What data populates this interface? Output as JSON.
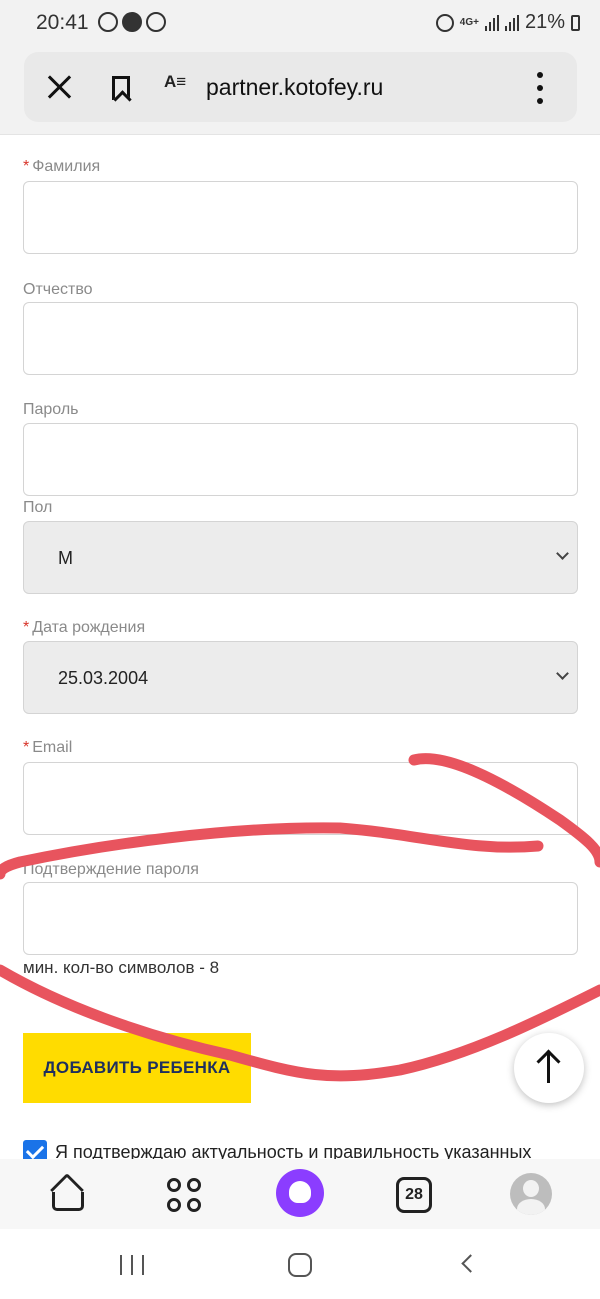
{
  "status_bar": {
    "time": "20:41",
    "network": "4G+",
    "battery": "21%",
    "icons": [
      "whatsapp-icon",
      "notification-icon",
      "whatsapp-icon",
      "alarm-icon",
      "signal-icon",
      "battery-icon"
    ]
  },
  "browser": {
    "url": "partner.kotofey.ru",
    "reader_glyph": "A",
    "icons": [
      "close-icon",
      "bookmark-icon",
      "reader-mode-icon",
      "more-vert-icon"
    ]
  },
  "form": {
    "required_mark": "*",
    "last_name_label": "Фамилия",
    "last_name_value": "",
    "middle_name_label": "Отчество",
    "middle_name_value": "",
    "password_label": "Пароль",
    "password_value": "",
    "gender_label": "Пол",
    "gender_value": "М",
    "birthdate_label": "Дата рождения",
    "birthdate_value": "25.03.2004",
    "email_label": "Email",
    "email_value": "",
    "confirm_password_label": "Подтверждение пароля",
    "confirm_password_value": "",
    "password_hint": "мин. кол-во символов - 8",
    "add_child_button": "ДОБАВИТЬ РЕБЕНКА",
    "consent_text": "Я подтверждаю актуальность и правильность указанных",
    "consent_checked": true
  },
  "annotation": {
    "color": "#e8545e"
  },
  "bottom_nav": {
    "tabs_count": "28",
    "icons": [
      "home-icon",
      "services-grid-icon",
      "alice-assistant-icon",
      "tabs-icon",
      "profile-avatar-icon"
    ]
  },
  "system_nav": {
    "icons": [
      "recents-icon",
      "home-button-icon",
      "back-icon"
    ]
  },
  "colors": {
    "accent_button": "#ffdc00",
    "button_text": "#1e2f5e",
    "required": "#d8352a",
    "checkbox": "#1a73e8",
    "alice": "#8b3dff"
  }
}
